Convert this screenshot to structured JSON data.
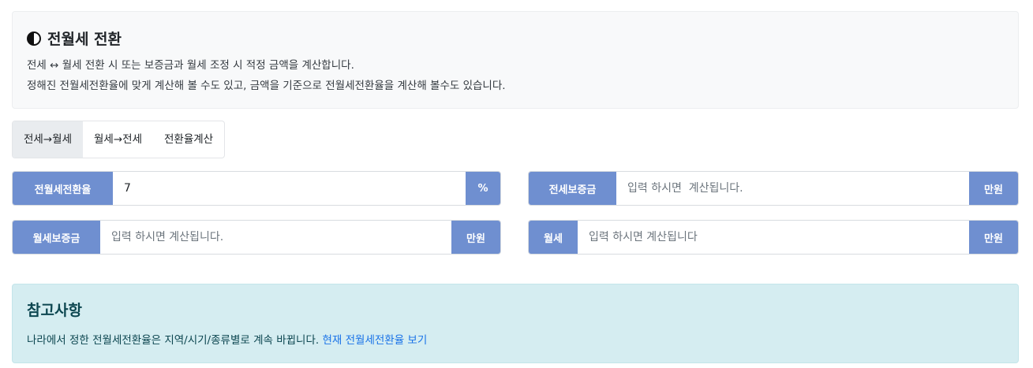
{
  "info": {
    "title": "전월세 전환",
    "desc_line1": "전세 ↔ 월세 전환 시 또는 보증금과 월세 조정 시 적정 금액을 계산합니다.",
    "desc_line2": "정해진 전월세전환율에 맞게 계산해 볼 수도 있고, 금액을 기준으로 전월세전환율을 계산해 볼수도 있습니다."
  },
  "tabs": [
    {
      "label": "전세→월세",
      "active": true
    },
    {
      "label": "월세→전세",
      "active": false
    },
    {
      "label": "전환율계산",
      "active": false
    }
  ],
  "fields": {
    "rate": {
      "label": "전월세전환율",
      "value": "7",
      "placeholder": "",
      "unit": "%"
    },
    "jeonse_deposit": {
      "label": "전세보증금",
      "value": "",
      "placeholder": "입력 하시면  계산됩니다.",
      "unit": "만원"
    },
    "wolse_deposit": {
      "label": "월세보증금",
      "value": "",
      "placeholder": "입력 하시면 계산됩니다.",
      "unit": "만원"
    },
    "wolse": {
      "label": "월세",
      "value": "",
      "placeholder": "입력 하시면 계산됩니다",
      "unit": "만원"
    }
  },
  "note": {
    "title": "참고사항",
    "text": "나라에서 정한 전월세전환율은 지역/시기/종류별로 계속 바뀝니다.",
    "link": "현재 전월세전환율 보기"
  },
  "colors": {
    "accent": "#6f8fd0",
    "note_bg": "#d5edf1",
    "link": "#1a73e8"
  }
}
